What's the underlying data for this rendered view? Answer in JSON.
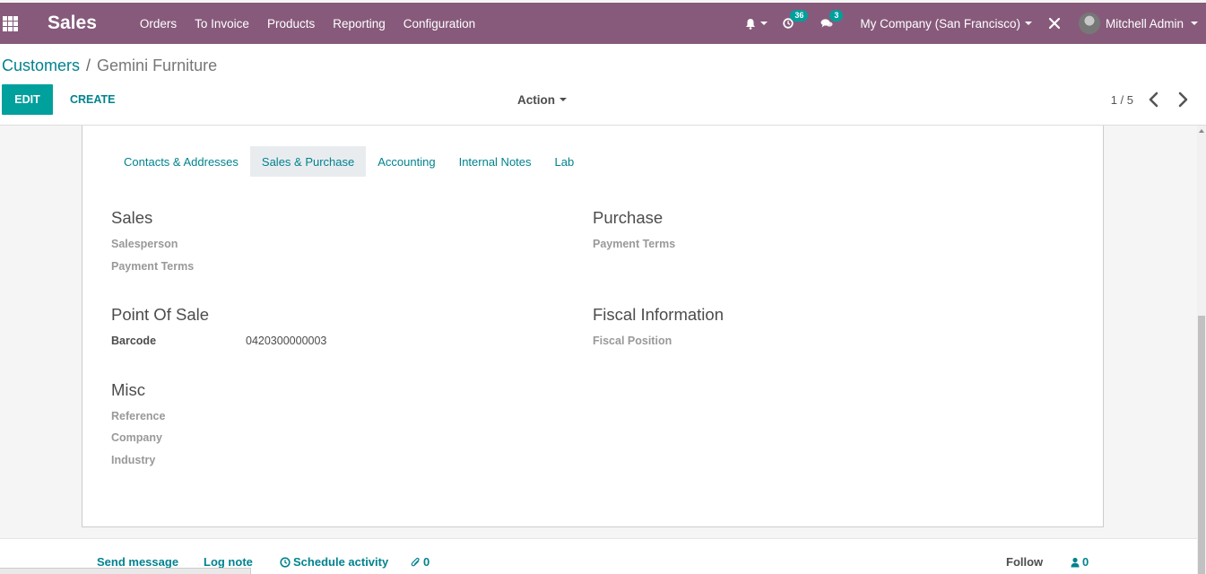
{
  "navbar": {
    "app_name": "Sales",
    "menu": [
      "Orders",
      "To Invoice",
      "Products",
      "Reporting",
      "Configuration"
    ],
    "activity_count": "36",
    "message_count": "3",
    "company": "My Company (San Francisco)",
    "user": "Mitchell Admin",
    "brand_color": "#875a7b"
  },
  "breadcrumb": {
    "parent": "Customers",
    "separator": "/",
    "current": "Gemini Furniture"
  },
  "buttons": {
    "edit": "EDIT",
    "create": "CREATE",
    "action": "Action"
  },
  "pager": {
    "value": "1 / 5"
  },
  "tabs": [
    "Contacts & Addresses",
    "Sales & Purchase",
    "Accounting",
    "Internal Notes",
    "Lab"
  ],
  "active_tab": "Sales & Purchase",
  "sections": {
    "sales": {
      "title": "Sales",
      "fields": [
        "Salesperson",
        "Payment Terms"
      ]
    },
    "purchase": {
      "title": "Purchase",
      "fields": [
        "Payment Terms"
      ]
    },
    "pos": {
      "title": "Point Of Sale",
      "barcode_label": "Barcode",
      "barcode_value": "0420300000003"
    },
    "fiscal": {
      "title": "Fiscal Information",
      "fields": [
        "Fiscal Position"
      ]
    },
    "misc": {
      "title": "Misc",
      "fields": [
        "Reference",
        "Company",
        "Industry"
      ]
    }
  },
  "chatter": {
    "send_message": "Send message",
    "log_note": "Log note",
    "schedule_activity": "Schedule activity",
    "attachments": "0",
    "follow": "Follow",
    "followers": "0"
  },
  "accent_color": "#00a09d"
}
